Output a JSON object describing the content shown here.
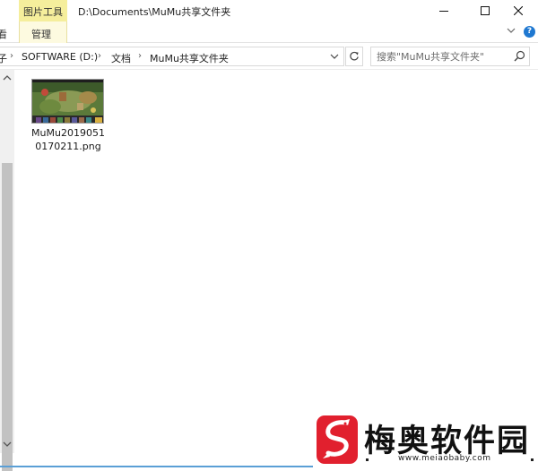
{
  "window": {
    "tool_tab_header": "图片工具",
    "path_title": "D:\\Documents\\MuMu共享文件夹",
    "controls": {
      "minimize": "minimize-icon",
      "maximize": "maximize-icon",
      "close": "close-icon"
    }
  },
  "ribbon": {
    "partial_tab": "看",
    "manage_tab": "管理"
  },
  "address_bar": {
    "leading_glyph": "子",
    "crumbs": [
      "SOFTWARE (D:)",
      "文档",
      "MuMu共享文件夹"
    ],
    "separator": "›"
  },
  "search": {
    "placeholder": "搜索\"MuMu共享文件夹\""
  },
  "files": [
    {
      "name_line1": "MuMu2019051",
      "name_line2": "0170211.png",
      "thumbnail": "game-screenshot-thumbnail"
    }
  ],
  "watermark": {
    "name": "梅奥软件园",
    "url": "www.meiaobaby.com",
    "brand_color": "#e1202e"
  },
  "colors": {
    "tool_tab": "#f5ee9c",
    "accent": "#1f78d1"
  }
}
